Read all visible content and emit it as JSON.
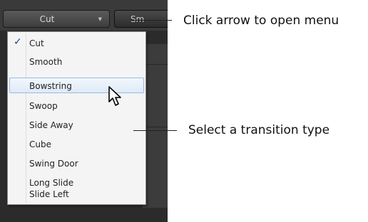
{
  "toolbar": {
    "dropdown_label": "Cut",
    "second_button_label": "Sm"
  },
  "menu": {
    "items": [
      {
        "label": "Cut",
        "checked": true
      },
      {
        "label": "Smooth"
      },
      {
        "label": "Bowstring",
        "highlighted": true
      },
      {
        "label": "Swoop"
      },
      {
        "label": "Side Away"
      },
      {
        "label": "Cube"
      },
      {
        "label": "Swing Door"
      },
      {
        "label": "Long Slide"
      },
      {
        "label": "Slide Left"
      }
    ]
  },
  "callouts": {
    "open_menu": "Click arrow to open menu",
    "select_type": "Select a transition type"
  },
  "colors": {
    "menu_bg": "#f4f4f4",
    "highlight_border": "#9cbbe3",
    "check": "#1c3f96",
    "app_bg": "#2b2b2b"
  }
}
